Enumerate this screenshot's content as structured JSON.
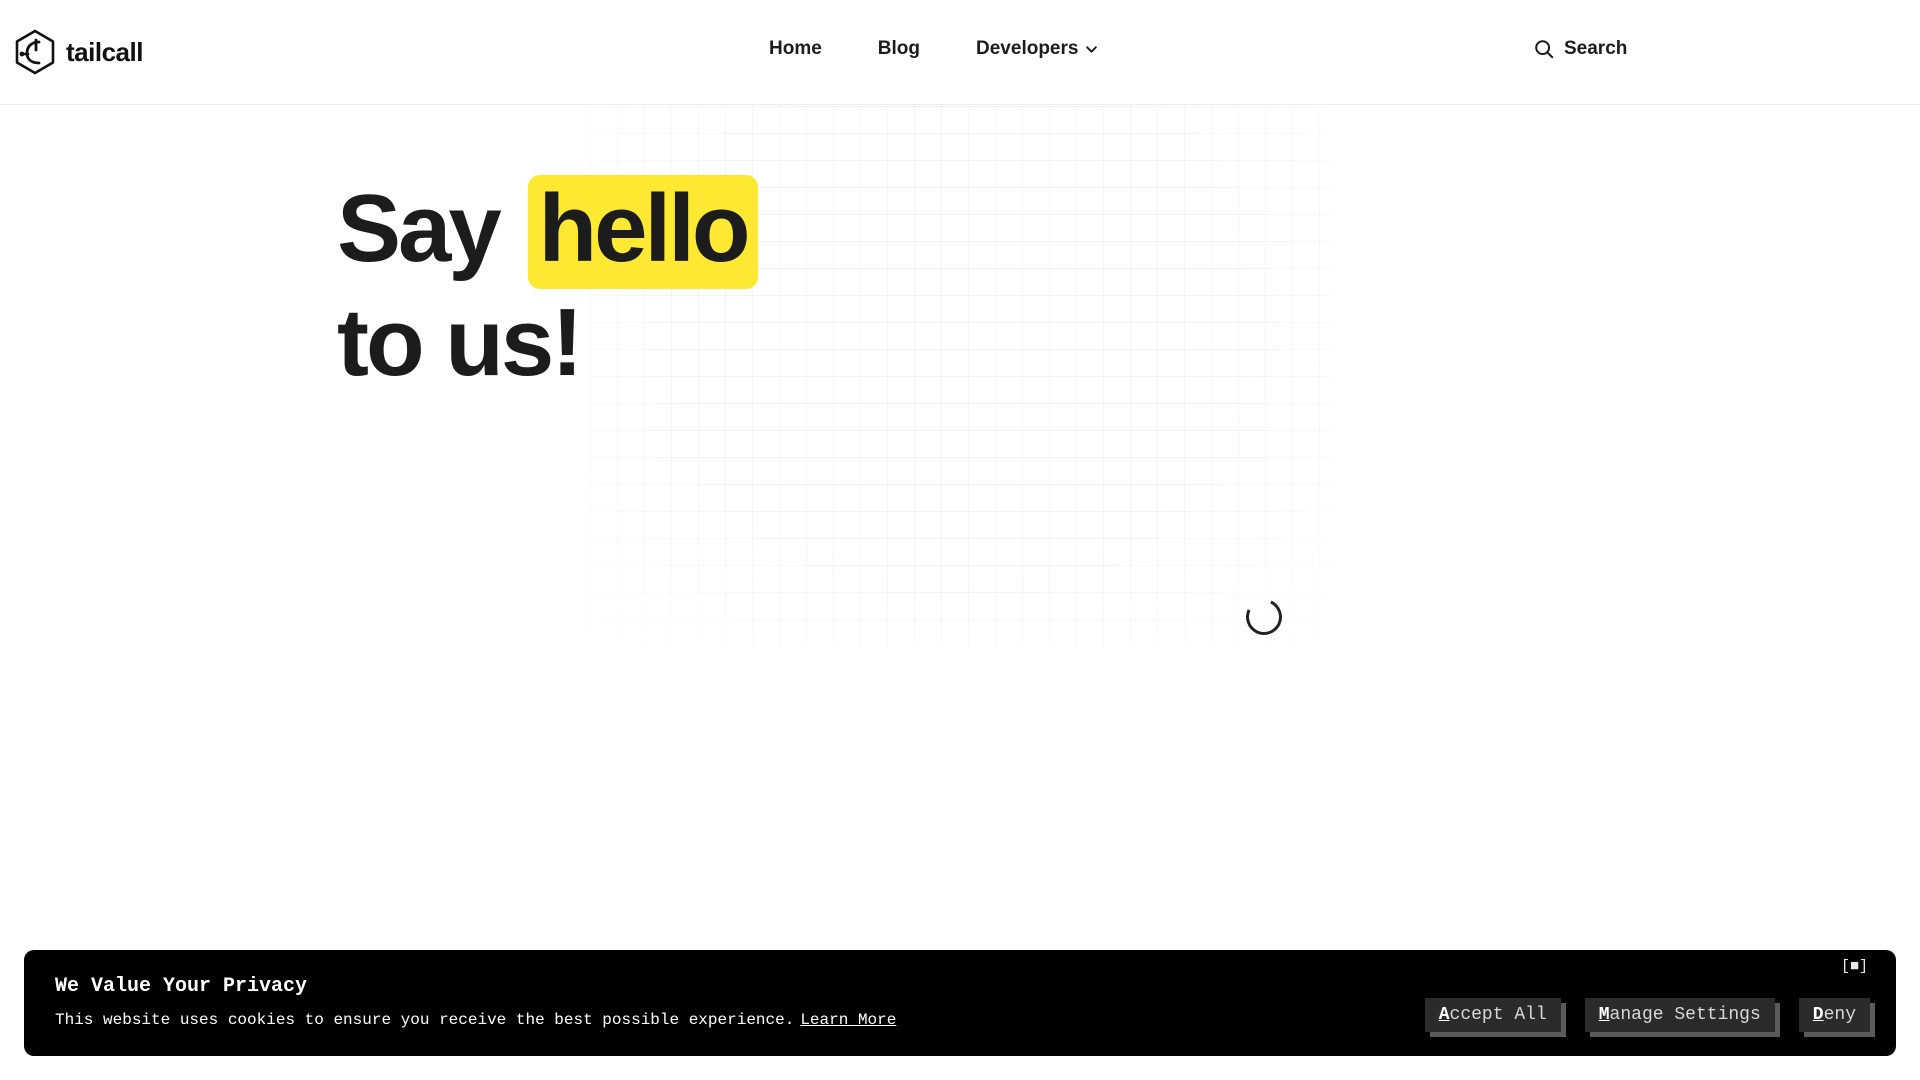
{
  "header": {
    "logo_text": "tailcall",
    "nav": [
      {
        "label": "Home"
      },
      {
        "label": "Blog"
      },
      {
        "label": "Developers"
      }
    ],
    "search_label": "Search"
  },
  "hero": {
    "line1_prefix": "Say",
    "highlight": "hello",
    "line2": "to us!"
  },
  "cookie": {
    "title": "We Value Your Privacy",
    "text": "This website uses cookies to ensure you receive the best possible experience.",
    "link": "Learn More",
    "close": "[■]",
    "buttons": [
      {
        "hot": "A",
        "rest": "ccept All"
      },
      {
        "hot": "M",
        "rest": "anage Settings"
      },
      {
        "hot": "D",
        "rest": "eny"
      }
    ]
  },
  "colors": {
    "highlight": "#fde832",
    "banner_bg": "#000000",
    "button_bg": "#2b2b2b"
  },
  "icons": [
    "tailcall-logo-icon",
    "chevron-down-icon",
    "search-icon",
    "loading-spinner-icon"
  ]
}
